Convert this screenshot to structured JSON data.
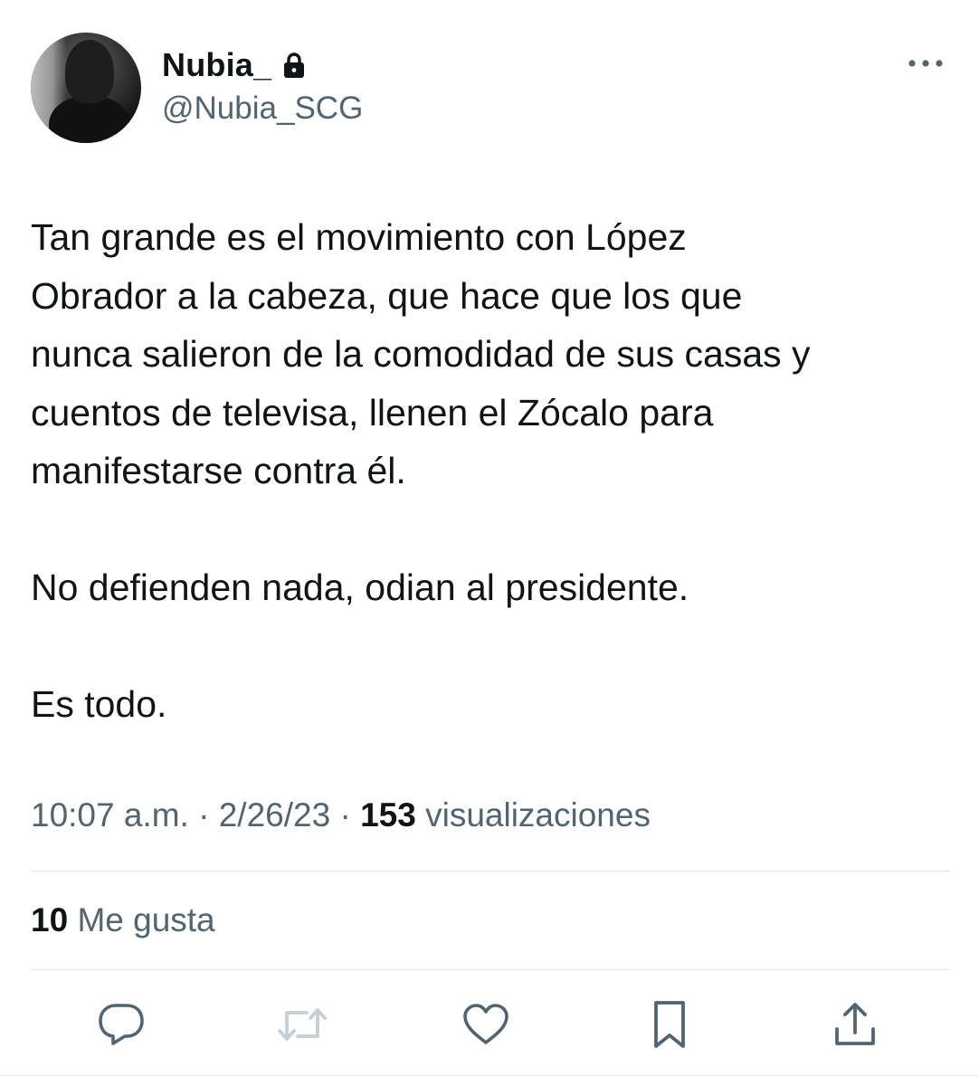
{
  "user": {
    "display_name": "Nubia_",
    "handle": "@Nubia_SCG",
    "protected_icon": "lock-icon",
    "avatar": "profile-photo"
  },
  "tweet": {
    "text": "Tan grande es el movimiento con López\nObrador a la cabeza, que hace que los que\nnunca salieron de la comodidad de sus casas y\ncuentos de televisa, llenen el Zócalo para\nmanifestarse contra él.\n\nNo defienden nada, odian al presidente.\n\nEs todo.",
    "time": "10:07 a.m.",
    "separator": "·",
    "date": "2/26/23",
    "views_count": "153",
    "views_label": "visualizaciones"
  },
  "engagement": {
    "likes_count": "10",
    "likes_label": "Me gusta"
  },
  "actions": {
    "reply_icon": "reply-icon",
    "retweet_icon": "retweet-icon",
    "like_icon": "heart-icon",
    "bookmark_icon": "bookmark-icon",
    "share_icon": "share-icon",
    "more_icon": "more-icon"
  },
  "colors": {
    "text_primary": "#0f1419",
    "text_secondary": "#536471",
    "icon_default": "#536471",
    "icon_disabled": "#c4cfd6",
    "divider": "#e1e6ea"
  }
}
